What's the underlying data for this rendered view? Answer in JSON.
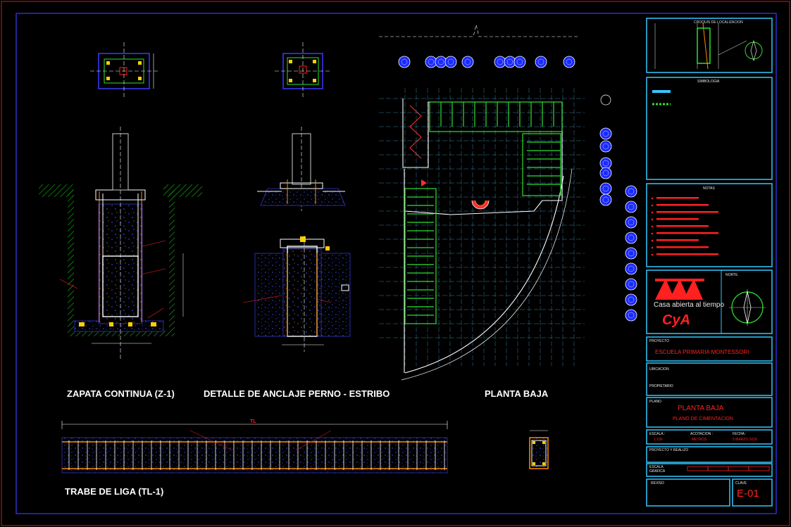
{
  "titles": {
    "zapata": "ZAPATA CONTINUA (Z-1)",
    "anclaje": "DETALLE DE ANCLAJE PERNO - ESTRIBO",
    "planta": "PLANTA BAJA",
    "trabe": "TRABE DE LIGA (TL-1)"
  },
  "dims": {
    "tl": "TL"
  },
  "titleblock": {
    "croquis": "CROQUIS DE LOCALIZACION",
    "simbologia": "SIMBOLOGIA",
    "notas": "NOTAS",
    "norte": "NORTE",
    "logo_tag": "Casa abierta al tiempo",
    "logo_mark": "CyA",
    "proyecto_label": "PROYECTO",
    "proyecto": "ESCUELA PRIMARIA MONTESSORI",
    "ubicacion_label": "UBICACION",
    "propietario_label": "PROPIETARIO",
    "plano_label": "PLANO",
    "plano_title": "PLANTA BAJA",
    "plano_sub": "PLANO DE CIMENTACION",
    "escala_label": "ESCALA :",
    "acot_label": "ACOTACION :",
    "fecha_label": "FECHA :",
    "escala": "1:100",
    "acot": "METROS",
    "fecha": "5 MARZO 2018",
    "proyecto_realizo": "PROYECTO Y REALIZO",
    "escala_grafica": "ESCALA GRAFICA",
    "reviso": "REVISO",
    "clave_label": "CLAVE",
    "clave": "E-01"
  },
  "colors": {
    "frame_red": "#c81e1e",
    "frame_blue": "#3a3aff",
    "rebar_green": "#2ee02e",
    "concrete_blue": "#2a2aa0",
    "column_blue": "#1a2aff",
    "tb_cyan": "#32c8ff",
    "orange": "#ff8a00",
    "grid_green": "#6ad27a"
  }
}
